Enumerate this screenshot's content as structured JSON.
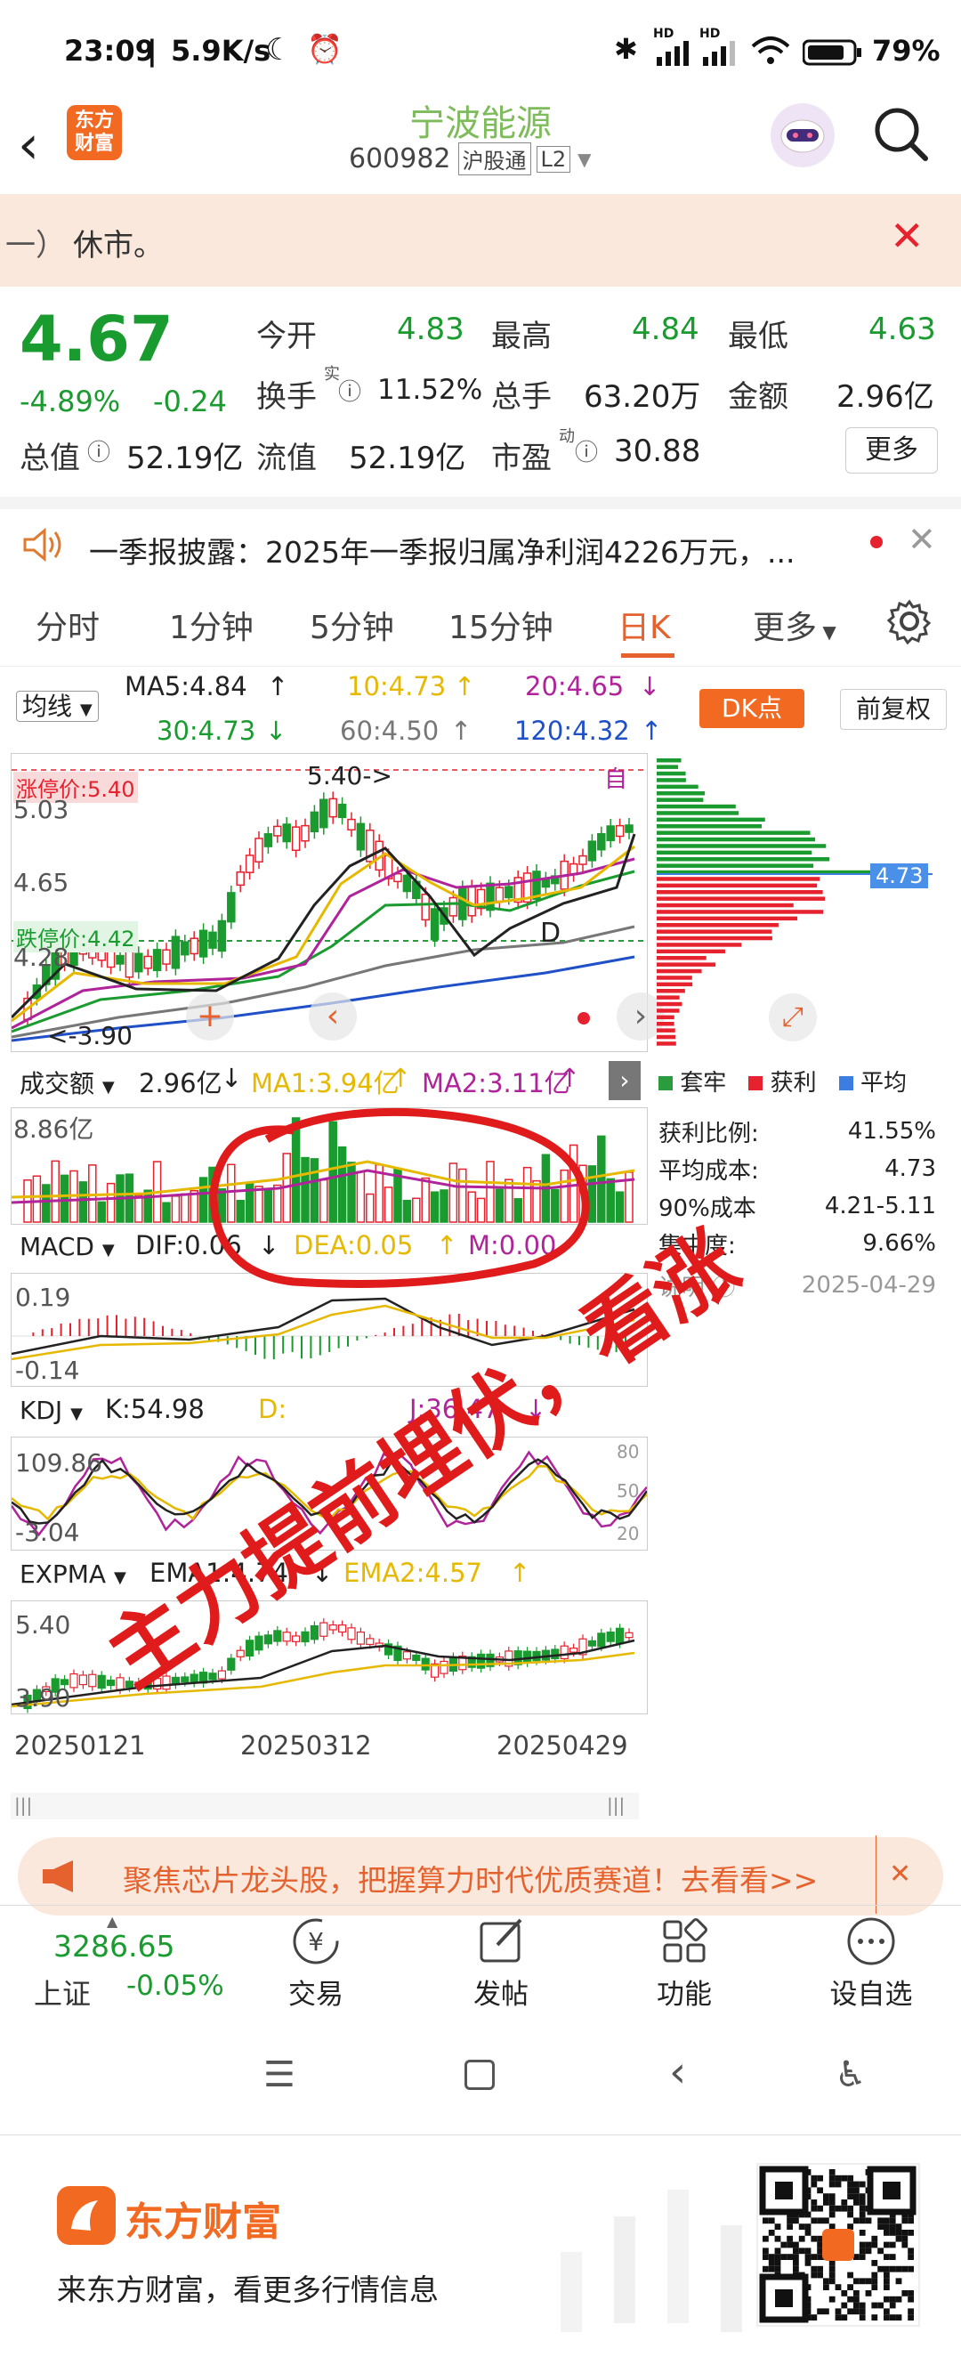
{
  "status_bar": {
    "time": "23:09",
    "speed": "5.9K/s",
    "battery": "79%",
    "hd1": "HD",
    "hd2": "HD"
  },
  "header": {
    "title": "宁波能源",
    "code": "600982",
    "market": "沪股通",
    "level": "L2",
    "logo_line1": "东方",
    "logo_line2": "财富"
  },
  "notice": {
    "prefix": "一）",
    "text": "休市。"
  },
  "quote": {
    "price": "4.67",
    "change_pct": "-4.89%",
    "change": "-0.24",
    "open_label": "今开",
    "open": "4.83",
    "high_label": "最高",
    "high": "4.84",
    "low_label": "最低",
    "low": "4.63",
    "turnover_label": "换手",
    "turnover_sup": "实",
    "turnover": "11.52%",
    "volume_label": "总手",
    "volume": "63.20万",
    "amount_label": "金额",
    "amount": "2.96亿",
    "mktcap_label": "总值",
    "mktcap": "52.19亿",
    "float_label": "流值",
    "float": "52.19亿",
    "pe_label": "市盈",
    "pe_sup": "动",
    "pe": "30.88",
    "more_button": "更多"
  },
  "announcement": {
    "text": "一季报披露：2025年一季报归属净利润4226万元，..."
  },
  "tabs": [
    "分时",
    "1分钟",
    "5分钟",
    "15分钟",
    "日K",
    "更多"
  ],
  "active_tab": "日K",
  "ma_bar": {
    "selector": "均线",
    "ma5": "MA5:4.84",
    "ma10": "10:4.73",
    "ma20": "20:4.65",
    "ma30": "30:4.73",
    "ma60": "60:4.50",
    "ma120": "120:4.32",
    "dk_button": "DK点",
    "adjust_button": "前复权"
  },
  "kline": {
    "limit_up_label": "涨停价:5.40",
    "limit_down_label": "跌停价:4.42",
    "y_503": "5.03",
    "y_465": "4.65",
    "y_428": "4.28",
    "high_annot": "5.40->",
    "low_annot": "<-3.90",
    "self_badge": "自",
    "d_mark": "D",
    "price_tag": "4.73"
  },
  "volume": {
    "selector": "成交额",
    "value": "2.96亿",
    "ma1": "MA1:3.94亿",
    "ma2": "MA2:3.11亿",
    "y_max": "8.86亿"
  },
  "chip_panel": {
    "legend": [
      "套牢",
      "获利",
      "平均"
    ],
    "rows": [
      {
        "label": "获利比例:",
        "value": "41.55%"
      },
      {
        "label": "平均成本:",
        "value": "4.73"
      },
      {
        "label": "90%成本",
        "value": "4.21-5.11"
      },
      {
        "label": "集中度:",
        "value": "9.66%"
      }
    ],
    "note_label": "说明",
    "date": "2025-04-29"
  },
  "macd": {
    "selector": "MACD",
    "dif": "DIF:0.06",
    "dea": "DEA:0.05",
    "m": "M:0.00",
    "y_top": "0.19",
    "y_bot": "-0.14"
  },
  "kdj": {
    "selector": "KDJ",
    "k": "K:54.98",
    "d": "D:",
    "j": "J:36.47",
    "y_top": "109.86",
    "y_bot": "-3.04",
    "r80": "80",
    "r50": "50",
    "r20": "20"
  },
  "expma": {
    "selector": "EXPMA",
    "ema1": "EMA1:4.74",
    "ema2": "EMA2:4.57",
    "y_top": "5.40",
    "y_bot": "3.90"
  },
  "dates": [
    "20250121",
    "20250312",
    "20250429"
  ],
  "handwriting": "主力提前埋伏，看涨",
  "promo": {
    "text": "聚焦芯片龙头股，把握算力时代优质赛道！去看看>>"
  },
  "bottom_bar": {
    "index_value": "3286.65",
    "index_name": "上证",
    "index_change": "-0.05%",
    "items": [
      "交易",
      "发帖",
      "功能",
      "设自选"
    ]
  },
  "brand": {
    "name": "东方财富",
    "slogan": "来东方财富，看更多行情信息"
  },
  "colors": {
    "up": "#e5222e",
    "down": "#1a9b2f",
    "accent": "#f26a21",
    "ma5": "#222222",
    "ma10": "#e6b800",
    "ma20": "#b0239a",
    "ma30": "#1a9b2f",
    "ma60": "#777777",
    "ma120": "#1f50c8"
  }
}
